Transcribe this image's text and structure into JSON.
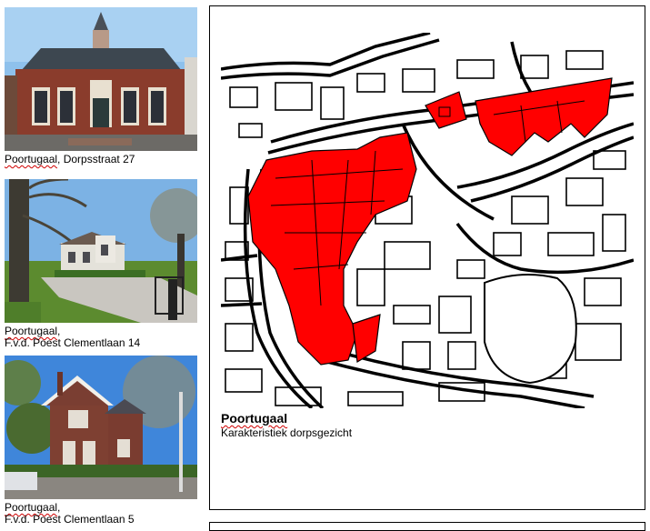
{
  "photos": [
    {
      "place": "Poortugaal",
      "address": ", Dorpsstraat 27"
    },
    {
      "place": "Poortugaal",
      "address": "F.v.d. Poest Clementlaan 14"
    },
    {
      "place": "Poortugaal",
      "address": "F.v.d. Poest Clementlaan 5"
    }
  ],
  "map": {
    "title": "Poortugaal",
    "subtitle": "Karakteristiek dorpsgezicht",
    "highlight_color": "#ff0000"
  }
}
